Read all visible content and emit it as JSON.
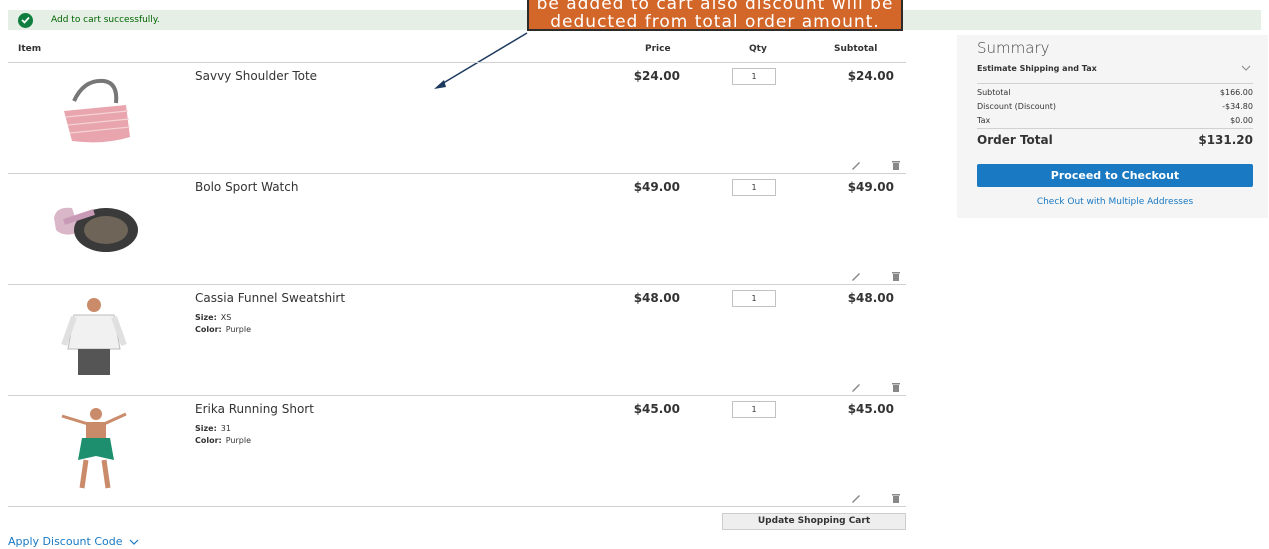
{
  "message": {
    "text": "Add to cart successfully."
  },
  "callout": {
    "line1": "be added to cart also discount will be",
    "line2": "deducted from total order amount."
  },
  "cart": {
    "headers": {
      "item": "Item",
      "price": "Price",
      "qty": "Qty",
      "subtotal": "Subtotal"
    },
    "items": [
      {
        "name": "Savvy Shoulder Tote",
        "price": "$24.00",
        "qty": "1",
        "subtotal": "$24.00"
      },
      {
        "name": "Bolo Sport Watch",
        "price": "$49.00",
        "qty": "1",
        "subtotal": "$49.00"
      },
      {
        "name": "Cassia Funnel Sweatshirt",
        "price": "$48.00",
        "qty": "1",
        "subtotal": "$48.00",
        "size_label": "Size:",
        "size": "XS",
        "color_label": "Color:",
        "color": "Purple"
      },
      {
        "name": "Erika Running Short",
        "price": "$45.00",
        "qty": "1",
        "subtotal": "$45.00",
        "size_label": "Size:",
        "size": "31",
        "color_label": "Color:",
        "color": "Purple"
      }
    ],
    "update_label": "Update Shopping Cart",
    "discount_label": "Apply Discount Code"
  },
  "summary": {
    "title": "Summary",
    "estimate_label": "Estimate Shipping and Tax",
    "subtotal_label": "Subtotal",
    "subtotal": "$166.00",
    "discount_label": "Discount (Discount)",
    "discount": "-$34.80",
    "tax_label": "Tax",
    "tax": "$0.00",
    "order_total_label": "Order Total",
    "order_total": "$131.20",
    "checkout_label": "Proceed to Checkout",
    "multi_label": "Check Out with Multiple Addresses"
  },
  "colors": {
    "accent": "#1979c3",
    "success": "#0f7e3f",
    "callout": "#d3672a"
  },
  "icons": [
    "check-icon",
    "edit-icon",
    "trash-icon",
    "chevron-down-icon"
  ]
}
